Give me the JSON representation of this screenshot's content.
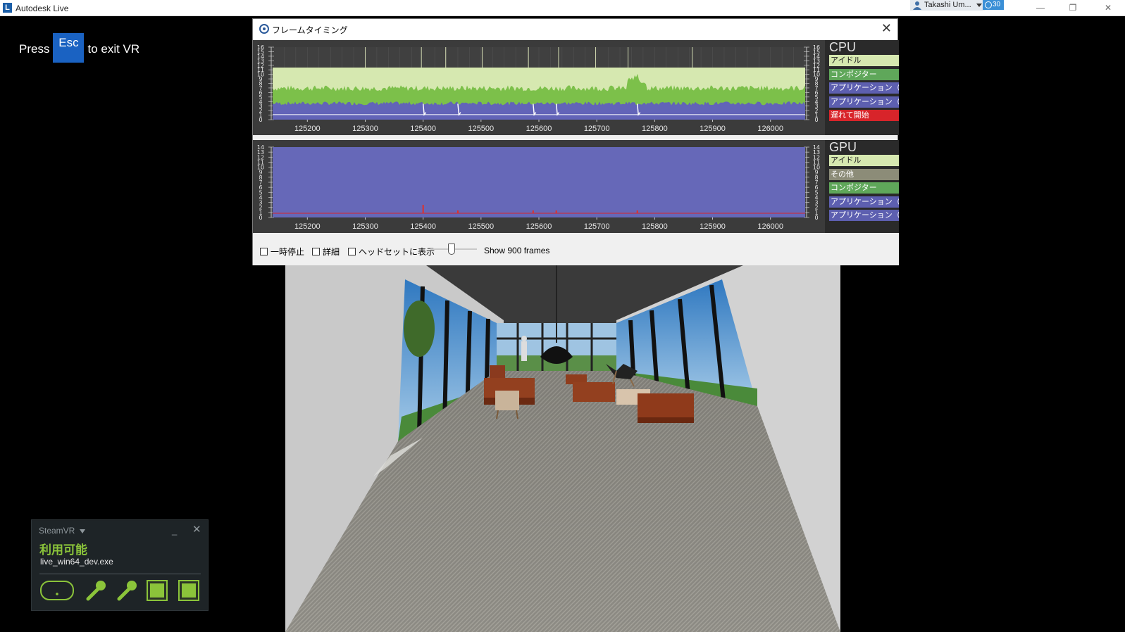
{
  "app": {
    "title": "Autodesk Live",
    "logo_letter": "L",
    "user_name": "Takashi Um...",
    "badge_count": "30"
  },
  "vr_hint": {
    "prefix": "Press",
    "key": "Esc",
    "suffix": "to exit VR"
  },
  "frame_timing": {
    "title": "フレームタイミング",
    "close_glyph": "✕",
    "cpu": {
      "label": "CPU",
      "legend": [
        {
          "label": "アイドル",
          "color": "#d6e8b0",
          "text_color": "#222"
        },
        {
          "label": "コンポジター",
          "color": "#5fa75a",
          "text_color": "#fff"
        },
        {
          "label": "アプリケーション（その",
          "color": "#5d5fb0",
          "text_color": "#fff"
        },
        {
          "label": "アプリケーション（背景",
          "color": "#5d5fb0",
          "text_color": "#fff"
        },
        {
          "label": "遅れて開始",
          "color": "#d8242a",
          "text_color": "#fff"
        }
      ],
      "y_ticks": [
        "0",
        "1",
        "2",
        "3",
        "4",
        "5",
        "6",
        "7",
        "8",
        "9",
        "10",
        "11",
        "12",
        "13",
        "14",
        "15",
        "16"
      ]
    },
    "gpu": {
      "label": "GPU",
      "legend": [
        {
          "label": "アイドル",
          "color": "#d6e8b0",
          "text_color": "#222"
        },
        {
          "label": "その他",
          "color": "#8c8c78",
          "text_color": "#fff"
        },
        {
          "label": "コンポジター",
          "color": "#5fa75a",
          "text_color": "#fff"
        },
        {
          "label": "アプリケーション（その",
          "color": "#5d5fb0",
          "text_color": "#fff"
        },
        {
          "label": "アプリケーション（背景",
          "color": "#5d5fb0",
          "text_color": "#fff"
        }
      ],
      "y_ticks": [
        "0",
        "1",
        "2",
        "3",
        "4",
        "5",
        "6",
        "7",
        "8",
        "9",
        "10",
        "11",
        "12",
        "13",
        "14"
      ]
    },
    "x_ticks": [
      "125200",
      "125300",
      "125400",
      "125500",
      "125600",
      "125700",
      "125800",
      "125900",
      "126000"
    ],
    "x_range": [
      125140,
      126060
    ],
    "cpu_spike_frames": [
      125400,
      125460,
      125590,
      125630,
      125770
    ],
    "cpu_marker_frames": [
      125300,
      125397,
      125439,
      125502,
      125582,
      125634,
      125698,
      125754,
      125865
    ],
    "toolbar": {
      "pause": "一時停止",
      "details": "詳細",
      "show_headset": "ヘッドセットに表示",
      "frames_label": "Show 900 frames"
    }
  },
  "steamvr": {
    "title": "SteamVR",
    "status": "利用可能",
    "exe": "live_win64_dev.exe",
    "min_glyph": "_",
    "close_glyph": "✕"
  },
  "colors": {
    "cpu_idle": "#d6e8b0",
    "cpu_compositor": "#7cc04a",
    "cpu_app": "#6264b8",
    "gpu_app": "#6668b8",
    "late_start": "#d8242a",
    "steamvr_green": "#8bc43a"
  }
}
